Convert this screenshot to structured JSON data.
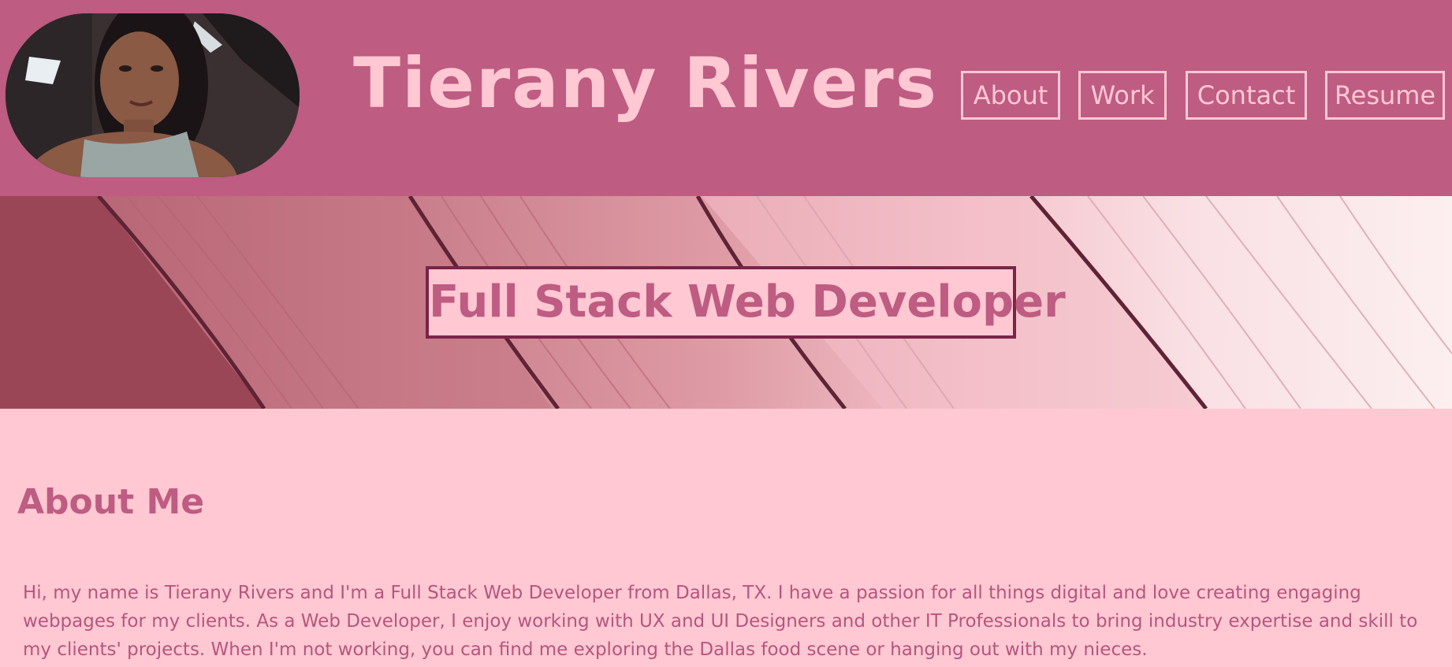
{
  "header": {
    "title": "Tierany Rivers",
    "avatar_alt": "Profile photo of Tierany Rivers",
    "nav": [
      {
        "label": "About"
      },
      {
        "label": "Work"
      },
      {
        "label": "Contact"
      },
      {
        "label": "Resume"
      }
    ]
  },
  "hero": {
    "headline": "Full Stack Web Developer"
  },
  "about": {
    "heading": "About Me",
    "body": "Hi, my name is Tierany Rivers and I'm a Full Stack Web Developer from Dallas, TX. I have a passion for all things digital and love creating engaging webpages for my clients. As a Web Developer, I enjoy working with UX and UI Designers and other IT Professionals to bring industry expertise and skill to my clients' projects. When I'm not working, you can find me exploring the Dallas food scene or hanging out with my nieces."
  },
  "colors": {
    "header_bg": "#be5c82",
    "page_bg": "#ffc8d3",
    "accent_text": "#ffc8d3",
    "heading_text": "#be5c82",
    "hero_border": "#7a2448"
  }
}
